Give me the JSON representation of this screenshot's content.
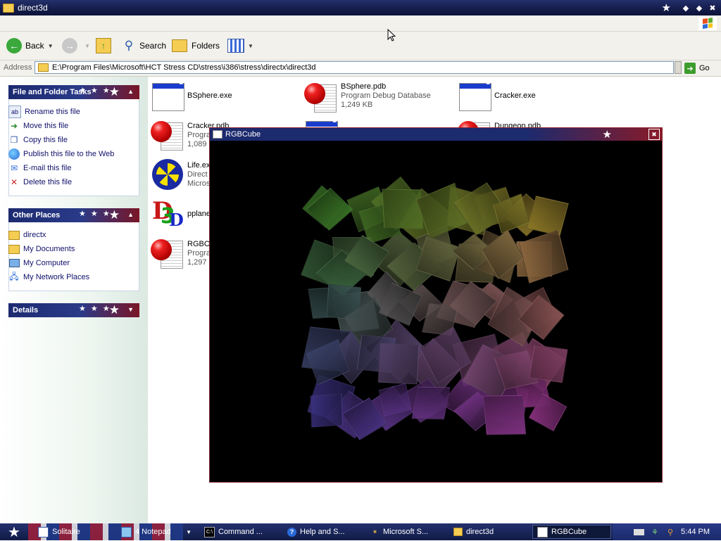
{
  "explorer": {
    "title": "direct3d",
    "toolbar": {
      "back_label": "Back",
      "search_label": "Search",
      "folders_label": "Folders"
    },
    "address": {
      "label": "Address",
      "path": "E:\\Program Files\\Microsoft\\HCT Stress CD\\stress\\i386\\stress\\directx\\direct3d",
      "go_label": "Go"
    }
  },
  "left_pane": {
    "file_tasks": {
      "title": "File and Folder Tasks",
      "items": [
        {
          "label": "Rename this file",
          "icon": "rename-icon"
        },
        {
          "label": "Move this file",
          "icon": "move-icon"
        },
        {
          "label": "Copy this file",
          "icon": "copy-icon"
        },
        {
          "label": "Publish this file to the Web",
          "icon": "globe-icon"
        },
        {
          "label": "E-mail this file",
          "icon": "email-icon"
        },
        {
          "label": "Delete this file",
          "icon": "delete-icon"
        }
      ]
    },
    "other_places": {
      "title": "Other Places",
      "items": [
        {
          "label": "directx",
          "icon": "folder-icon"
        },
        {
          "label": "My Documents",
          "icon": "documents-icon"
        },
        {
          "label": "My Computer",
          "icon": "computer-icon"
        },
        {
          "label": "My Network Places",
          "icon": "network-icon"
        }
      ]
    },
    "details": {
      "title": "Details"
    }
  },
  "files": [
    {
      "name": "BSphere.exe",
      "type": "exe"
    },
    {
      "name": "BSphere.pdb",
      "desc": "Program Debug Database",
      "size": "1,249 KB",
      "type": "pdb"
    },
    {
      "name": "Cracker.exe",
      "type": "exe"
    },
    {
      "name": "Cracker.pdb",
      "desc": "Progra",
      "size": "1,089",
      "type": "pdb"
    },
    {
      "name": "Dungeon.pdb",
      "type": "pdb"
    },
    {
      "name": "Life.ex",
      "desc": "Direct",
      "size": "Micros",
      "type": "life"
    },
    {
      "name": "pplane",
      "type": "d3d"
    },
    {
      "name": "RGBCu",
      "desc": "Progra",
      "size": "1,297",
      "type": "pdb"
    }
  ],
  "rgbcube_window": {
    "title": "RGBCube"
  },
  "taskbar": {
    "buttons": [
      {
        "label": "Solitaire",
        "icon": "solitaire-icon"
      },
      {
        "label": "4 Notepad",
        "icon": "notepad-icon"
      },
      {
        "label": "Command ...",
        "icon": "cmd-icon"
      },
      {
        "label": "Help and S...",
        "icon": "help-icon"
      },
      {
        "label": "Microsoft S...",
        "icon": "tool-icon"
      },
      {
        "label": "direct3d",
        "icon": "folder-icon"
      },
      {
        "label": "RGBCube",
        "icon": "window-icon"
      }
    ],
    "clock": "5:44 PM"
  },
  "colors": {
    "title_bar": "#141c4a",
    "panel_header_left": "#1c2a70",
    "panel_header_right": "#7a1626",
    "task_link": "#10106a"
  }
}
